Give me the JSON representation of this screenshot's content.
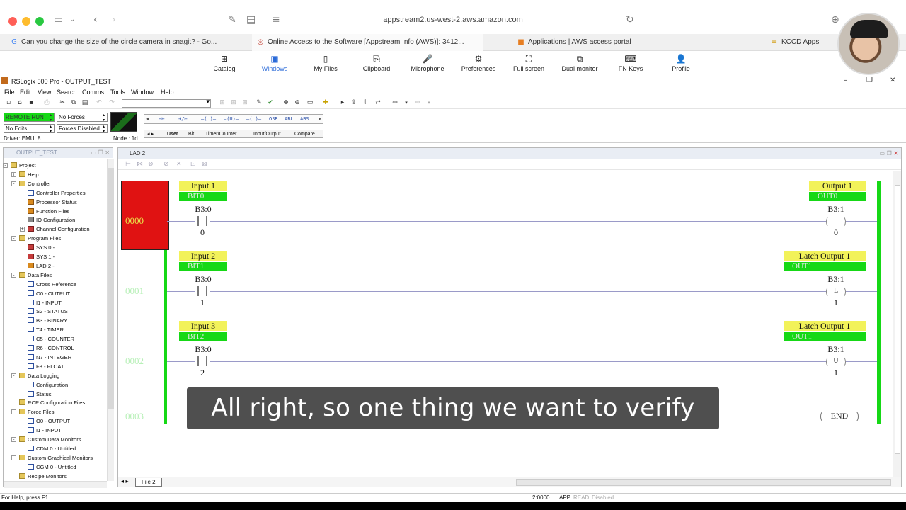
{
  "browser": {
    "url": "appstream2.us-west-2.aws.amazon.com",
    "tabs": [
      {
        "favicon": "G",
        "title": "Can you change the size of the circle camera in snagit? - Go..."
      },
      {
        "favicon": "◎",
        "title": "Online Access to the Software [Appstream Info (AWS)]: 3412..."
      },
      {
        "favicon": "■",
        "title": "Applications | AWS access portal"
      },
      {
        "favicon": "≡",
        "title": "KCCD Apps"
      }
    ]
  },
  "appstream": {
    "items": [
      {
        "icon": "⊞",
        "label": "Catalog"
      },
      {
        "icon": "▣",
        "label": "Windows"
      },
      {
        "icon": "▯",
        "label": "My Files"
      },
      {
        "icon": "⎘",
        "label": "Clipboard"
      },
      {
        "icon": "🎤",
        "label": "Microphone"
      },
      {
        "icon": "⚙",
        "label": "Preferences"
      },
      {
        "icon": "⛶",
        "label": "Full screen"
      },
      {
        "icon": "⧉",
        "label": "Dual monitor"
      },
      {
        "icon": "⌨",
        "label": "FN Keys"
      },
      {
        "icon": "👤",
        "label": "Profile"
      }
    ],
    "accent": "#2a6ad8"
  },
  "app": {
    "title": "RSLogix 500 Pro - OUTPUT_TEST",
    "menu": [
      "File",
      "Edit",
      "View",
      "Search",
      "Comms",
      "Tools",
      "Window",
      "Help"
    ]
  },
  "status": {
    "mode": "REMOTE RUN",
    "forces": "No Forces",
    "edits": "No Edits",
    "forces_enabled": "Forces Disabled",
    "driver": "Driver: EMUL8",
    "node": "Node : 1d",
    "instr_tabs": [
      "User",
      "Bit",
      "Timer/Counter",
      "Input/Output",
      "Compare"
    ],
    "instr_buttons": [
      "⊣⊢",
      "⊣/⊢",
      "–( )–",
      "–(U)–",
      "–(L)–",
      "OSR",
      "ABL",
      "ABS"
    ]
  },
  "project": {
    "title": "OUTPUT_TEST...",
    "items": [
      {
        "label": "Project",
        "icon": "folder",
        "indent": 0,
        "exp": "-"
      },
      {
        "label": "Help",
        "icon": "folder",
        "indent": 1,
        "exp": "+"
      },
      {
        "label": "Controller",
        "icon": "folder",
        "indent": 1,
        "exp": "-"
      },
      {
        "label": "Controller Properties",
        "icon": "doc",
        "indent": 2
      },
      {
        "label": "Processor Status",
        "icon": "orange",
        "indent": 2
      },
      {
        "label": "Function Files",
        "icon": "orange",
        "indent": 2
      },
      {
        "label": "IO Configuration",
        "icon": "gray",
        "indent": 2
      },
      {
        "label": "Channel Configuration",
        "icon": "red",
        "indent": 2,
        "exp": "+"
      },
      {
        "label": "Program Files",
        "icon": "folder",
        "indent": 1,
        "exp": "-"
      },
      {
        "label": "SYS 0 -",
        "icon": "red",
        "indent": 2
      },
      {
        "label": "SYS 1 -",
        "icon": "red",
        "indent": 2
      },
      {
        "label": "LAD 2 -",
        "icon": "orange",
        "indent": 2
      },
      {
        "label": "Data Files",
        "icon": "folder",
        "indent": 1,
        "exp": "-"
      },
      {
        "label": "Cross Reference",
        "icon": "doc",
        "indent": 2
      },
      {
        "label": "O0 - OUTPUT",
        "icon": "doc",
        "indent": 2
      },
      {
        "label": "I1 - INPUT",
        "icon": "doc",
        "indent": 2
      },
      {
        "label": "S2 - STATUS",
        "icon": "doc",
        "indent": 2
      },
      {
        "label": "B3 - BINARY",
        "icon": "doc",
        "indent": 2
      },
      {
        "label": "T4 - TIMER",
        "icon": "doc",
        "indent": 2
      },
      {
        "label": "C5 - COUNTER",
        "icon": "doc",
        "indent": 2
      },
      {
        "label": "R6 - CONTROL",
        "icon": "doc",
        "indent": 2
      },
      {
        "label": "N7 - INTEGER",
        "icon": "doc",
        "indent": 2
      },
      {
        "label": "F8 - FLOAT",
        "icon": "doc",
        "indent": 2
      },
      {
        "label": "Data Logging",
        "icon": "folder",
        "indent": 1,
        "exp": "-"
      },
      {
        "label": "Configuration",
        "icon": "doc",
        "indent": 2
      },
      {
        "label": "Status",
        "icon": "doc",
        "indent": 2
      },
      {
        "label": "RCP Configuration Files",
        "icon": "folder",
        "indent": 1
      },
      {
        "label": "Force Files",
        "icon": "folder",
        "indent": 1,
        "exp": "-"
      },
      {
        "label": "O0 - OUTPUT",
        "icon": "doc",
        "indent": 2
      },
      {
        "label": "I1 - INPUT",
        "icon": "doc",
        "indent": 2
      },
      {
        "label": "Custom Data Monitors",
        "icon": "folder",
        "indent": 1,
        "exp": "-"
      },
      {
        "label": "CDM 0 - Untitled",
        "icon": "doc",
        "indent": 2
      },
      {
        "label": "Custom Graphical Monitors",
        "icon": "folder",
        "indent": 1,
        "exp": "-"
      },
      {
        "label": "CGM 0 - Untitled",
        "icon": "doc",
        "indent": 2
      },
      {
        "label": "Recipe Monitors",
        "icon": "folder",
        "indent": 1
      }
    ]
  },
  "ladder": {
    "title": "LAD 2",
    "file_tab": "File 2",
    "colors": {
      "rail": "#16d816",
      "selected": "#e01212",
      "desc": "#f2f25a",
      "symbol": "#16d816"
    },
    "rungs": [
      {
        "num": "0000",
        "in_desc": "Input 1",
        "in_sym": "BIT0",
        "in_addr": "B3:0",
        "in_bit": "0",
        "out_desc": "Output 1",
        "out_sym": "OUT0",
        "out_addr": "B3:1",
        "out_bit": "0",
        "out_type": ""
      },
      {
        "num": "0001",
        "in_desc": "Input 2",
        "in_sym": "BIT1",
        "in_addr": "B3:0",
        "in_bit": "1",
        "out_desc": "Latch Output 1",
        "out_sym": "OUT1",
        "out_addr": "B3:1",
        "out_bit": "1",
        "out_type": "L"
      },
      {
        "num": "0002",
        "in_desc": "Input 3",
        "in_sym": "BIT2",
        "in_addr": "B3:0",
        "in_bit": "2",
        "out_desc": "Latch Output 1",
        "out_sym": "OUT1",
        "out_addr": "B3:1",
        "out_bit": "1",
        "out_type": "U"
      },
      {
        "num": "0003",
        "end": "END"
      }
    ]
  },
  "statusbar": {
    "help": "For Help, press F1",
    "pos": "2:0000",
    "mode": "APP",
    "read": "READ",
    "disabled": "Disabled"
  },
  "caption": "All right, so one thing we want to verify"
}
